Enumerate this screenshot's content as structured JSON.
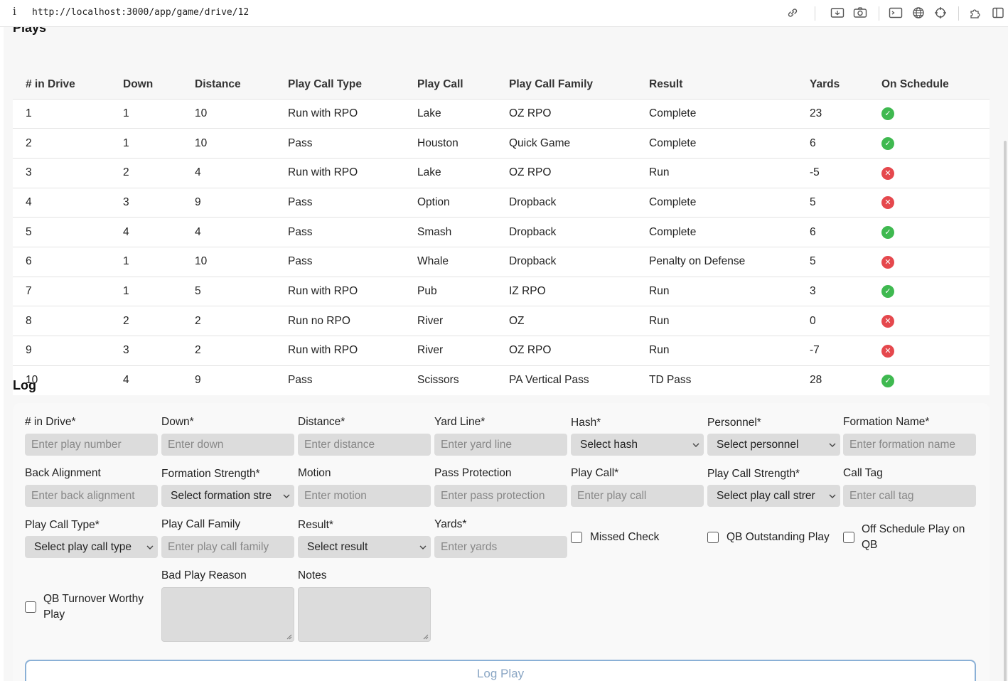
{
  "browser": {
    "info_glyph": "i",
    "url": "http://localhost:3000/app/game/drive/12"
  },
  "plays": {
    "title": "Plays",
    "columns": [
      "# in Drive",
      "Down",
      "Distance",
      "Play Call Type",
      "Play Call",
      "Play Call Family",
      "Result",
      "Yards",
      "On Schedule"
    ],
    "rows": [
      {
        "num": "1",
        "down": "1",
        "distance": "10",
        "type": "Run with RPO",
        "call": "Lake",
        "family": "OZ RPO",
        "result": "Complete",
        "yards": "23",
        "on_schedule": true
      },
      {
        "num": "2",
        "down": "1",
        "distance": "10",
        "type": "Pass",
        "call": "Houston",
        "family": "Quick Game",
        "result": "Complete",
        "yards": "6",
        "on_schedule": true
      },
      {
        "num": "3",
        "down": "2",
        "distance": "4",
        "type": "Run with RPO",
        "call": "Lake",
        "family": "OZ RPO",
        "result": "Run",
        "yards": "-5",
        "on_schedule": false
      },
      {
        "num": "4",
        "down": "3",
        "distance": "9",
        "type": "Pass",
        "call": "Option",
        "family": "Dropback",
        "result": "Complete",
        "yards": "5",
        "on_schedule": false
      },
      {
        "num": "5",
        "down": "4",
        "distance": "4",
        "type": "Pass",
        "call": "Smash",
        "family": "Dropback",
        "result": "Complete",
        "yards": "6",
        "on_schedule": true
      },
      {
        "num": "6",
        "down": "1",
        "distance": "10",
        "type": "Pass",
        "call": "Whale",
        "family": "Dropback",
        "result": "Penalty on Defense",
        "yards": "5",
        "on_schedule": false
      },
      {
        "num": "7",
        "down": "1",
        "distance": "5",
        "type": "Run with RPO",
        "call": "Pub",
        "family": "IZ RPO",
        "result": "Run",
        "yards": "3",
        "on_schedule": true
      },
      {
        "num": "8",
        "down": "2",
        "distance": "2",
        "type": "Run no RPO",
        "call": "River",
        "family": "OZ",
        "result": "Run",
        "yards": "0",
        "on_schedule": false
      },
      {
        "num": "9",
        "down": "3",
        "distance": "2",
        "type": "Run with RPO",
        "call": "River",
        "family": "OZ RPO",
        "result": "Run",
        "yards": "-7",
        "on_schedule": false
      },
      {
        "num": "10",
        "down": "4",
        "distance": "9",
        "type": "Pass",
        "call": "Scissors",
        "family": "PA Vertical Pass",
        "result": "TD Pass",
        "yards": "28",
        "on_schedule": true
      }
    ]
  },
  "log": {
    "title": "Log",
    "in_drive": {
      "label": "# in Drive*",
      "placeholder": "Enter play number"
    },
    "down": {
      "label": "Down*",
      "placeholder": "Enter down"
    },
    "distance": {
      "label": "Distance*",
      "placeholder": "Enter distance"
    },
    "yard_line": {
      "label": "Yard Line*",
      "placeholder": "Enter yard line"
    },
    "hash": {
      "label": "Hash*",
      "selected": "Select hash"
    },
    "personnel": {
      "label": "Personnel*",
      "selected": "Select personnel"
    },
    "formation_name": {
      "label": "Formation Name*",
      "placeholder": "Enter formation name"
    },
    "back_alignment": {
      "label": "Back Alignment",
      "placeholder": "Enter back alignment"
    },
    "formation_strength": {
      "label": "Formation Strength*",
      "selected": "Select formation stre"
    },
    "motion": {
      "label": "Motion",
      "placeholder": "Enter motion"
    },
    "pass_protection": {
      "label": "Pass Protection",
      "placeholder": "Enter pass protection"
    },
    "play_call": {
      "label": "Play Call*",
      "placeholder": "Enter play call"
    },
    "play_call_strength": {
      "label": "Play Call Strength*",
      "selected": "Select play call strer"
    },
    "call_tag": {
      "label": "Call Tag",
      "placeholder": "Enter call tag"
    },
    "play_call_type": {
      "label": "Play Call Type*",
      "selected": "Select play call type"
    },
    "play_call_family": {
      "label": "Play Call Family",
      "placeholder": "Enter play call family"
    },
    "result": {
      "label": "Result*",
      "selected": "Select result"
    },
    "yards": {
      "label": "Yards*",
      "placeholder": "Enter yards"
    },
    "missed_check": "Missed Check",
    "qb_outstanding": "QB Outstanding Play",
    "off_schedule": "Off Schedule Play on QB",
    "qb_turnover": "QB Turnover Worthy Play",
    "bad_play_reason": "Bad Play Reason",
    "notes": "Notes",
    "submit": "Log Play"
  },
  "colors": {
    "on_schedule": "#3fb950",
    "off_schedule": "#e5484d",
    "button_border": "#8ab0d6"
  }
}
